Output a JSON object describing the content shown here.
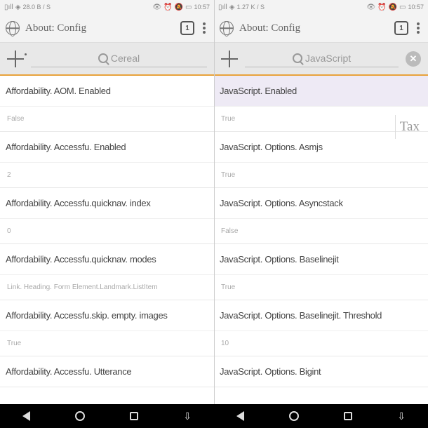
{
  "left": {
    "status": {
      "net": "28.0 B / S",
      "time": "10:57"
    },
    "title": "About: Config",
    "tabcount": "1",
    "search": "Cereal",
    "rows": [
      {
        "t": "Affordability. AOM. Enabled",
        "v": "False"
      },
      {
        "t": "Affordability. Accessfu. Enabled",
        "v": "2"
      },
      {
        "t": "Affordability. Accessfu.quicknav. index",
        "v": "0"
      },
      {
        "t": "Affordability. Accessfu.quicknav. modes",
        "v": "Link. Heading. Form Element.Landmark.ListItem"
      },
      {
        "t": "Affordability. Accessfu.skip. empty. images",
        "v": "True"
      },
      {
        "t": "Affordability. Accessfu. Utterance",
        "v": ""
      }
    ]
  },
  "right": {
    "status": {
      "net": "1.27 K / S",
      "time": "10:57"
    },
    "title": "About: Config",
    "tabcount": "1",
    "search": "JavaScript",
    "tax": "Tax",
    "rows": [
      {
        "t": "JavaScript. Enabled",
        "v": "True",
        "hl": true
      },
      {
        "t": "JavaScript. Options. Asmjs",
        "v": "True"
      },
      {
        "t": "JavaScript. Options. Asyncstack",
        "v": "False"
      },
      {
        "t": "JavaScript. Options. Baselinejit",
        "v": "True"
      },
      {
        "t": "JavaScript. Options. Baselinejit. Threshold",
        "v": "10"
      },
      {
        "t": "JavaScript. Options. Bigint",
        "v": ""
      }
    ]
  }
}
